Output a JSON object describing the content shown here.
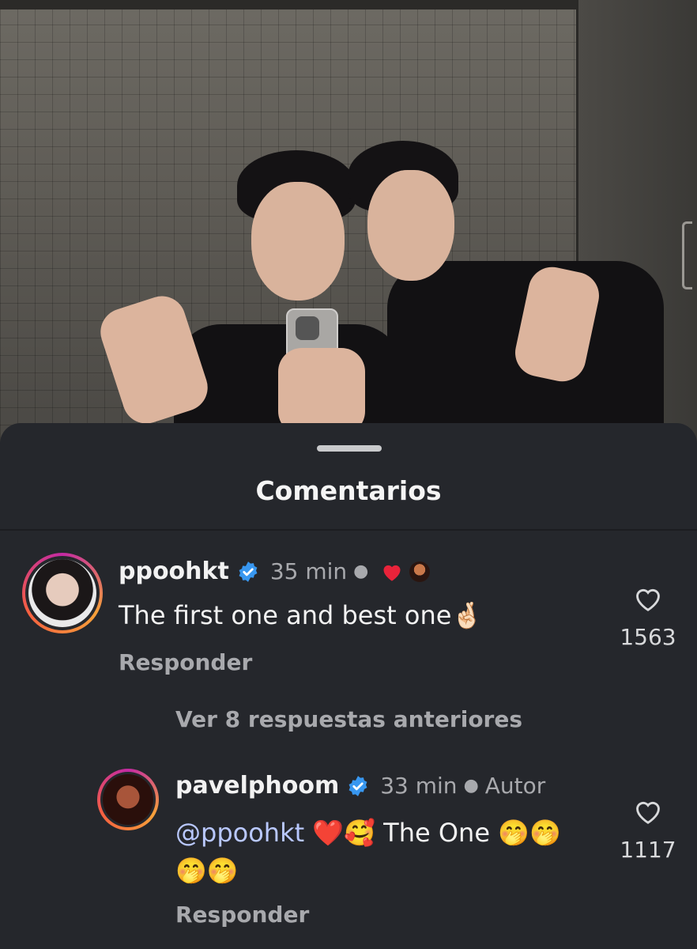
{
  "sheet": {
    "title": "Comentarios"
  },
  "comments": [
    {
      "username": "ppoohkt",
      "verified": true,
      "time": "35 min",
      "text": "The first one and best one🤞🏻",
      "reply_label": "Responder",
      "like_count": "1563"
    },
    {
      "username": "pavelphoom",
      "verified": true,
      "time": "33 min",
      "author_badge": "Autor",
      "mention": "@ppoohkt",
      "text_line1": " ❤️🥰 The One 🤭🤭",
      "text_line2": "🤭🤭",
      "reply_label": "Responder",
      "like_count": "1117"
    }
  ],
  "view_more_replies": "Ver 8 respuestas anteriores",
  "colors": {
    "sheet_bg": "#25272c",
    "verified_blue": "#3897f0",
    "heart_red": "#e8233a",
    "mention_blue": "#b9c8ff"
  }
}
